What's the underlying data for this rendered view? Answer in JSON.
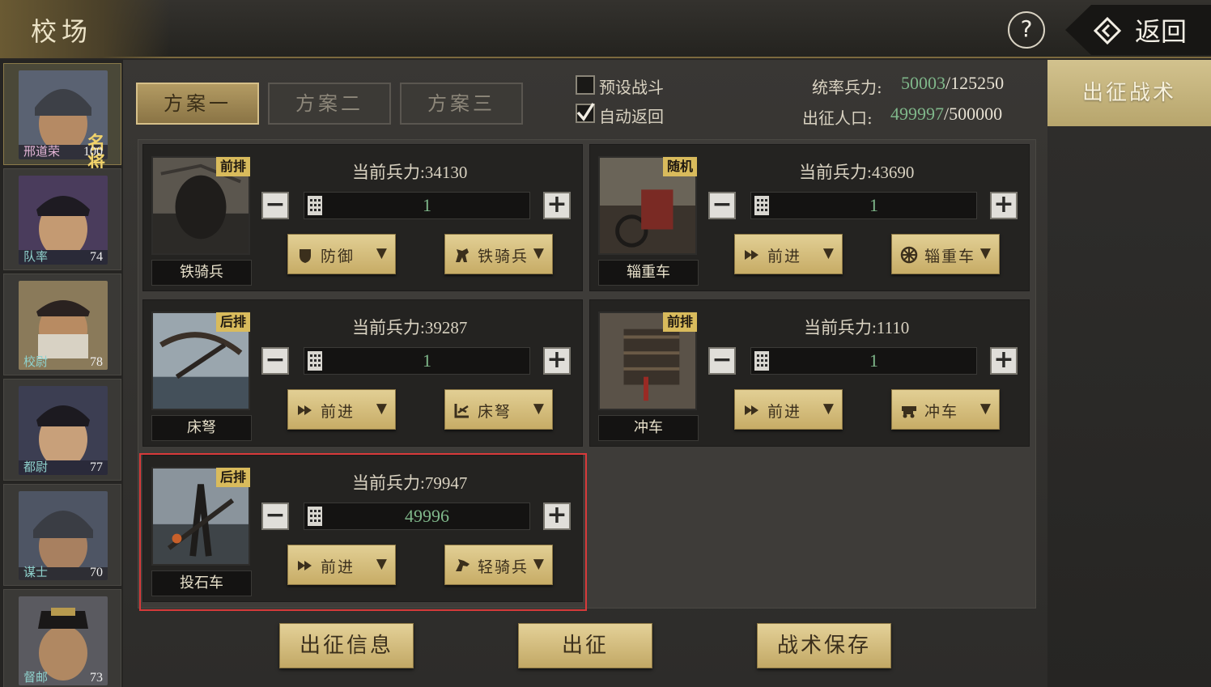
{
  "header": {
    "title": "校场",
    "help_label": "?",
    "back_label": "返回"
  },
  "generals": [
    {
      "name": "邢道荣",
      "level": "100",
      "badge": "名将",
      "selected": true
    },
    {
      "name": "队率",
      "level": "74"
    },
    {
      "name": "校尉",
      "level": "78"
    },
    {
      "name": "都尉",
      "level": "77"
    },
    {
      "name": "谋士",
      "level": "70"
    },
    {
      "name": "督邮",
      "level": "73"
    }
  ],
  "plans": {
    "tabs": [
      "方案一",
      "方案二",
      "方案三"
    ],
    "active": 0
  },
  "options": {
    "preset_battle": {
      "label": "预设战斗",
      "checked": false
    },
    "auto_return": {
      "label": "自动返回",
      "checked": true
    }
  },
  "stats": {
    "command_label": "统率兵力:",
    "command_current": "50003",
    "command_max": "/125250",
    "population_label": "出征人口:",
    "population_current": "499997",
    "population_max": "/500000"
  },
  "troops_label": "当前兵力:",
  "units": [
    {
      "name": "铁骑兵",
      "position": "前排",
      "troops": "34130",
      "count": "1",
      "stance": "防御",
      "target": "铁骑兵"
    },
    {
      "name": "辎重车",
      "position": "随机",
      "troops": "43690",
      "count": "1",
      "stance": "前进",
      "target": "辎重车"
    },
    {
      "name": "床弩",
      "position": "后排",
      "troops": "39287",
      "count": "1",
      "stance": "前进",
      "target": "床弩"
    },
    {
      "name": "冲车",
      "position": "前排",
      "troops": "1110",
      "count": "1",
      "stance": "前进",
      "target": "冲车"
    },
    {
      "name": "投石车",
      "position": "后排",
      "troops": "79947",
      "count": "49996",
      "stance": "前进",
      "target": "轻骑兵"
    }
  ],
  "buttons": {
    "expedition_info": "出征信息",
    "expedition": "出征",
    "save_tactics": "战术保存"
  },
  "right_panel": {
    "tab_label": "出征战术"
  },
  "colors": {
    "accent_gold": "#c7ac66",
    "green_value": "#7fb78a",
    "highlight_red": "#d83a3a"
  }
}
